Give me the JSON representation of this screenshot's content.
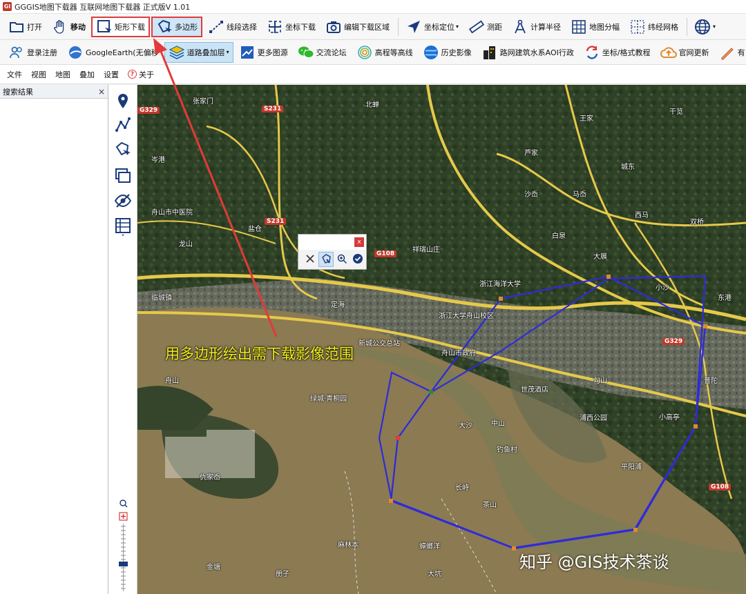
{
  "app": {
    "title": "GGGIS地图下载器  互联网地图下载器 正式版V 1.01",
    "icon_text": "GI"
  },
  "toolbar1": {
    "open": "打开",
    "move": "移动",
    "rect_download": "矩形下载",
    "polygon": "多边形",
    "line_select": "线段选择",
    "coord_download": "坐标下载",
    "edit_download_area": "编辑下载区域",
    "coord_locate": "坐标定位",
    "measure": "测距",
    "calc_radius": "计算半径",
    "map_tiles": "地图分幅",
    "latlon_grid": "纬经网格"
  },
  "toolbar2": {
    "login": "登录注册",
    "google_earth": "GoogleEarth(无偏移",
    "road_overlay": "道路叠加层",
    "more_sources": "更多图源",
    "forum": "交流论坛",
    "contour": "高程等高线",
    "history": "历史影像",
    "buildings": "路网建筑水系AOI行政",
    "coord_tutorial": "坐标/格式教程",
    "website_update": "官网更新",
    "overflow": "有"
  },
  "menu": {
    "file": "文件",
    "view": "视图",
    "map": "地图",
    "overlay": "叠加",
    "settings": "设置",
    "about": "关于",
    "about_icon": "?"
  },
  "side_panel": {
    "title": "搜索结果",
    "close": "×"
  },
  "popup": {
    "close": "x"
  },
  "map_labels": {
    "annotation": "用多边形绘出需下载影像范围",
    "watermark": "知乎 @GIS技术茶谈",
    "places": [
      "张家门",
      "王家",
      "芦家",
      "舟山市中医院",
      "龙山",
      "浙江海洋大学",
      "浙江大学舟山校区",
      "舟山市政府",
      "新城公交总站",
      "绿城·青桐园",
      "世茂酒店",
      "浦西公园",
      "临城镇",
      "小高亭",
      "大沙",
      "中山",
      "钓鱼村",
      "勾山",
      "平阳浦",
      "茶山",
      "仇家岙",
      "麻林本",
      "蟑螂洋",
      "舟山",
      "大坑",
      "沙岙",
      "马岙",
      "祥瑞山庄",
      "小沙",
      "城东",
      "干览",
      "双桥",
      "西马",
      "岑港",
      "长峙",
      "东港",
      "普陀",
      "定海",
      "盐仓",
      "白泉",
      "北蝉",
      "大展",
      "金塘",
      "册子"
    ],
    "roads": [
      "G329",
      "S231",
      "S231",
      "G108",
      "G329",
      "G108"
    ]
  },
  "colors": {
    "polygon_line": "#2f2bd9",
    "highlight_box": "#e23a3a",
    "annotation_text": "#f4f11a",
    "arrow": "#e23a3a"
  }
}
